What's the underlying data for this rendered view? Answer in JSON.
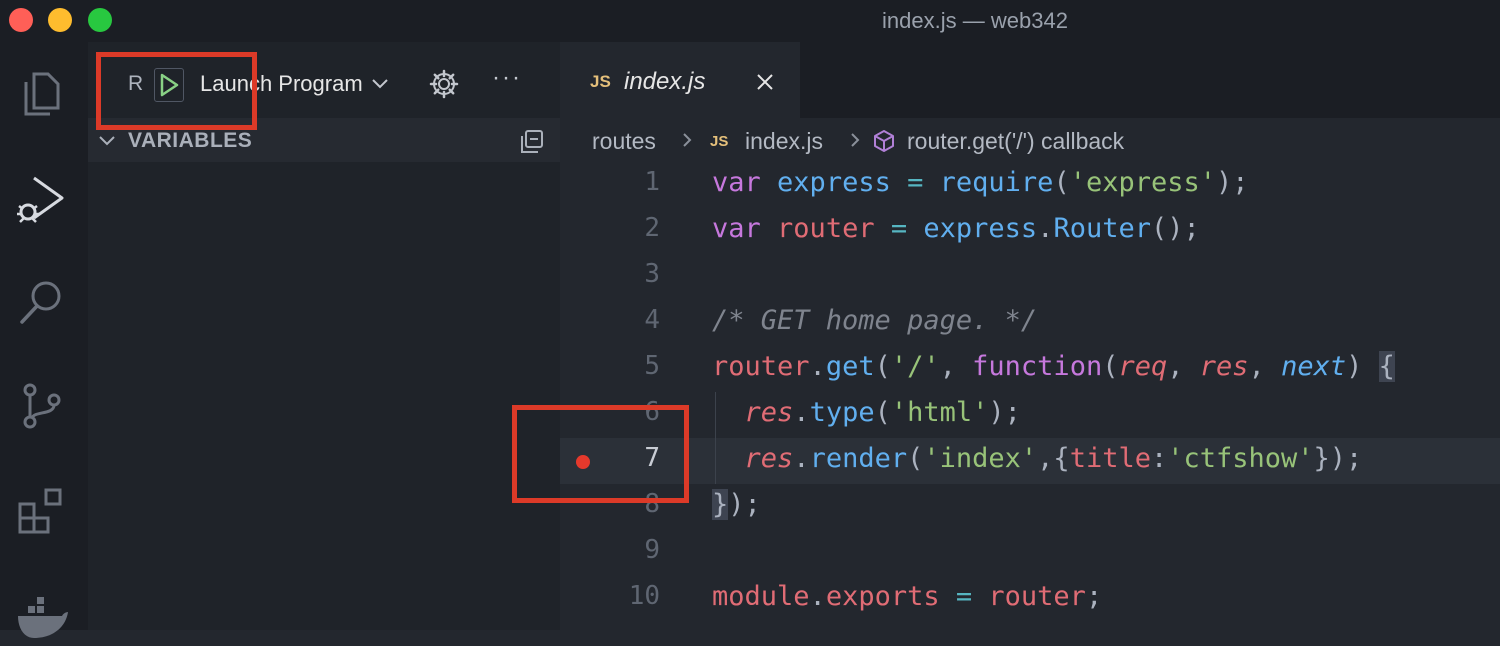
{
  "window": {
    "title": "index.js — web342"
  },
  "activity_bar": {
    "items": [
      {
        "name": "explorer",
        "icon": "files-icon"
      },
      {
        "name": "run-and-debug",
        "icon": "debug-icon"
      },
      {
        "name": "search",
        "icon": "search-icon"
      },
      {
        "name": "source-control",
        "icon": "source-control-icon"
      },
      {
        "name": "extensions",
        "icon": "extensions-icon"
      },
      {
        "name": "docker",
        "icon": "docker-icon"
      }
    ]
  },
  "debug_toolbar": {
    "run_label": "R",
    "play_icon": "play-icon",
    "config_label": "Launch Program",
    "more_label": "···"
  },
  "variables_panel": {
    "title": "VARIABLES"
  },
  "editor": {
    "tab": {
      "badge": "JS",
      "name": "index.js"
    },
    "breadcrumbs": {
      "folder": "routes",
      "file_badge": "JS",
      "file": "index.js",
      "symbol": "router.get('/') callback"
    },
    "active_line": 7,
    "breakpoint_line": 7,
    "lines": [
      {
        "n": "1",
        "text": "var express = require('express');"
      },
      {
        "n": "2",
        "text": "var router = express.Router();"
      },
      {
        "n": "3",
        "text": ""
      },
      {
        "n": "4",
        "text": "/* GET home page. */"
      },
      {
        "n": "5",
        "text": "router.get('/', function(req, res, next) {"
      },
      {
        "n": "6",
        "text": "  res.type('html');"
      },
      {
        "n": "7",
        "text": "  res.render('index',{title:'ctfshow'});"
      },
      {
        "n": "8",
        "text": "});"
      },
      {
        "n": "9",
        "text": ""
      },
      {
        "n": "10",
        "text": "module.exports = router;"
      }
    ]
  },
  "colors": {
    "breakpoint": "#e5392c",
    "annotation": "#dc3a28",
    "keyword": "#c678dd",
    "function": "#61afef",
    "string": "#98c379",
    "variable": "#e06c75"
  }
}
